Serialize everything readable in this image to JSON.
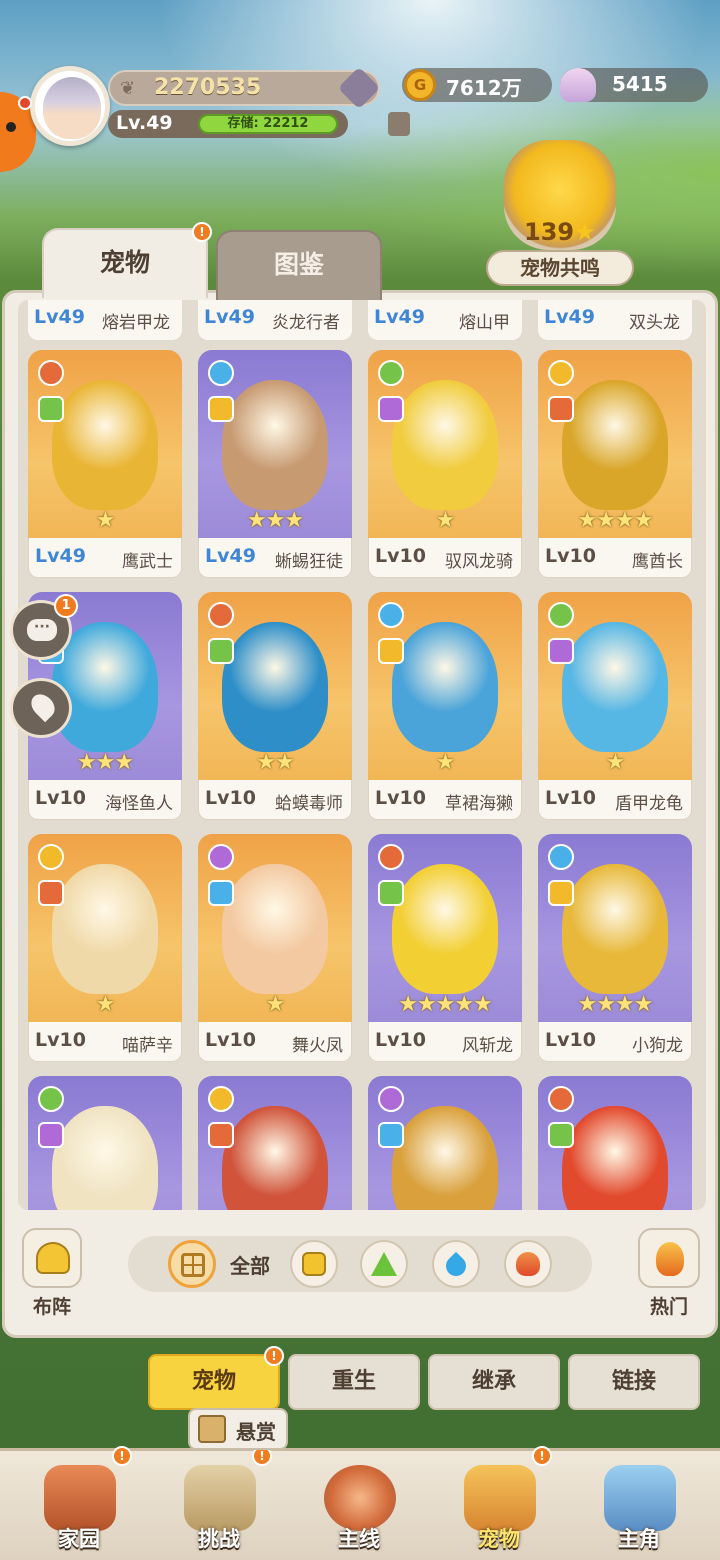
{
  "header": {
    "power": "2270535",
    "level": "Lv.49",
    "storage_label": "存储: 22212",
    "coins": "7612万",
    "shells": "5415"
  },
  "resonance": {
    "count": "139",
    "label": "宠物共鸣"
  },
  "tabs": {
    "pets": "宠物",
    "codex": "图鉴"
  },
  "top_row": [
    {
      "level": "Lv49",
      "name": "熔岩甲龙"
    },
    {
      "level": "Lv49",
      "name": "炎龙行者"
    },
    {
      "level": "Lv49",
      "name": "熔山甲"
    },
    {
      "level": "Lv49",
      "name": "双头龙"
    }
  ],
  "pets": [
    {
      "level": "Lv49",
      "name": "鹰武士",
      "stars": "★",
      "bg": "orange",
      "body": "#e9b535"
    },
    {
      "level": "Lv49",
      "name": "蜥蜴狂徒",
      "stars": "★★★",
      "bg": "purple",
      "body": "#c79a72"
    },
    {
      "level": "Lv10",
      "name": "驭风龙骑",
      "stars": "★",
      "bg": "orange",
      "body": "#f0cc3e"
    },
    {
      "level": "Lv10",
      "name": "鹰酋长",
      "stars": "★★★★",
      "bg": "orange",
      "body": "#d9a62a"
    },
    {
      "level": "Lv10",
      "name": "海怪鱼人",
      "stars": "★★★",
      "bg": "purple",
      "body": "#3fa9dc"
    },
    {
      "level": "Lv10",
      "name": "蛤蟆毒师",
      "stars": "★★",
      "bg": "orange",
      "body": "#2e8fc8"
    },
    {
      "level": "Lv10",
      "name": "草裙海獭",
      "stars": "★",
      "bg": "orange",
      "body": "#4aa3d9"
    },
    {
      "level": "Lv10",
      "name": "盾甲龙龟",
      "stars": "★",
      "bg": "orange",
      "body": "#56b6e4"
    },
    {
      "level": "Lv10",
      "name": "喵萨辛",
      "stars": "★",
      "bg": "orange",
      "body": "#f0d9a8"
    },
    {
      "level": "Lv10",
      "name": "舞火凤",
      "stars": "★",
      "bg": "orange",
      "body": "#f3c9a1"
    },
    {
      "level": "Lv10",
      "name": "风斩龙",
      "stars": "★★★★★",
      "bg": "purple",
      "body": "#f2cf33"
    },
    {
      "level": "Lv10",
      "name": "小狗龙",
      "stars": "★★★★",
      "bg": "purple",
      "body": "#e7b83a"
    },
    {
      "level": "",
      "name": "",
      "stars": "",
      "bg": "purple",
      "body": "#efe3c2"
    },
    {
      "level": "",
      "name": "",
      "stars": "",
      "bg": "purple",
      "body": "#d0533a"
    },
    {
      "level": "",
      "name": "",
      "stars": "",
      "bg": "purple",
      "body": "#d9a03c"
    },
    {
      "level": "",
      "name": "",
      "stars": "",
      "bg": "purple",
      "body": "#e24a2e"
    }
  ],
  "side": {
    "chat_badge": "1"
  },
  "filter": {
    "lineup": "布阵",
    "all": "全部",
    "hot": "热门"
  },
  "subtabs": [
    "宠物",
    "重生",
    "继承",
    "链接"
  ],
  "bounty": "悬赏",
  "nav": [
    "家园",
    "挑战",
    "主线",
    "宠物",
    "主角"
  ],
  "colors": {
    "accent": "#f7d33f",
    "level_high": "#3f86d6",
    "badge": "#f07c1f"
  }
}
